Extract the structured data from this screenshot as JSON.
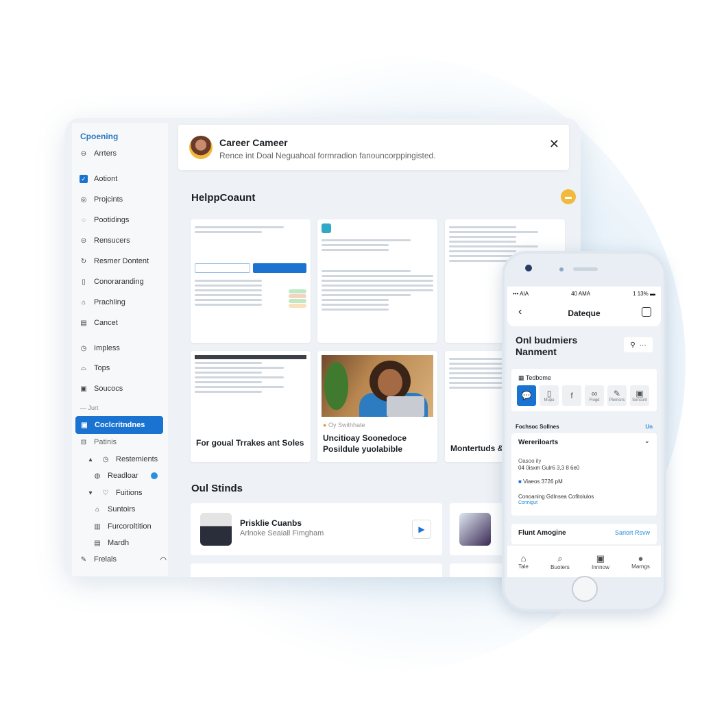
{
  "sidebar": {
    "header": "Cpoening",
    "items": [
      {
        "label": "Arrters",
        "icon": "drive-icon"
      },
      {
        "label": "Aotiont",
        "icon": "checkbox-icon",
        "checked": true
      },
      {
        "label": "Projcints",
        "icon": "at-icon"
      },
      {
        "label": "Pootidings",
        "icon": "circle-icon"
      },
      {
        "label": "Rensucers",
        "icon": "bag-icon"
      },
      {
        "label": "Resmer Dontent",
        "icon": "refresh-icon"
      },
      {
        "label": "Conoraranding",
        "icon": "clipboard-icon"
      },
      {
        "label": "Prachling",
        "icon": "home-icon"
      },
      {
        "label": "Cancet",
        "icon": "calendar-icon"
      },
      {
        "label": "Impless",
        "icon": "clock-icon"
      },
      {
        "label": "Tops",
        "icon": "bag-icon"
      },
      {
        "label": "Soucocs",
        "icon": "image-icon"
      }
    ],
    "separator": "Jurt",
    "selected": "Coclcritndnes",
    "after_selected": "Patinis",
    "tree": [
      {
        "label": "Restemients",
        "expanded": true
      },
      {
        "label": "Readloar",
        "badge": true
      },
      {
        "label": "Fuitions",
        "expanded": true
      },
      {
        "label": "Suntoirs"
      },
      {
        "label": "Furcoroltition"
      },
      {
        "label": "Mardh"
      }
    ],
    "footer": "Frelals"
  },
  "notification": {
    "title": "Career Cameer",
    "message": "Rence int Doal Neguahoal formradion fanouncorppingisted."
  },
  "sections": {
    "help": "HelppCoaunt",
    "stories": "Oul Stinds"
  },
  "cards": [
    {
      "caption": ""
    },
    {
      "caption": ""
    },
    {
      "caption": ""
    },
    {
      "caption": "For goual Trrakes ant Soles"
    },
    {
      "caption": "Uncitioay Soonedoce Posildule yuolabible",
      "tag": "Oy Swithhate"
    },
    {
      "caption": "Montertuds &"
    }
  ],
  "stories": [
    {
      "title": "Prisklie Cuanbs",
      "subtitle": "Arlnoke Seaiall Fimgham"
    }
  ],
  "phone": {
    "status_left": "••• AIA",
    "status_time": "40 AMA",
    "status_right": "1 13%",
    "nav_title": "Dateque",
    "page_title": "Onl budmiers Nanment",
    "toolbar_label": "Tedbome",
    "tools": [
      {
        "label": "",
        "glyph": "💬"
      },
      {
        "label": "Mupu",
        "glyph": "▯"
      },
      {
        "label": "",
        "glyph": "f"
      },
      {
        "label": "Flogd",
        "glyph": "∞"
      },
      {
        "label": "Plemsns",
        "glyph": "✎"
      },
      {
        "label": "Sensonl",
        "glyph": "▣"
      }
    ],
    "section_label": "Fochsoc Sollnes",
    "section_link": "Un",
    "dropdown": "Wereriloarts",
    "detail_label": "Oasoo ily",
    "detail_value": "04 0isxm Gulr6 3,3 8 6e0",
    "time": "Viaeos 3726 pM",
    "desc": "Conoaning Gdlnsea Cofitolulos",
    "desc_link": "Connigut",
    "footer_title": "Flunt Amogine",
    "footer_link": "Sariort Rsvw",
    "tabs": [
      {
        "label": "Tale",
        "glyph": "⌂"
      },
      {
        "label": "Buoters",
        "glyph": "⌕"
      },
      {
        "label": "Innnow",
        "glyph": "▣"
      },
      {
        "label": "Marngs",
        "glyph": "●"
      }
    ]
  }
}
